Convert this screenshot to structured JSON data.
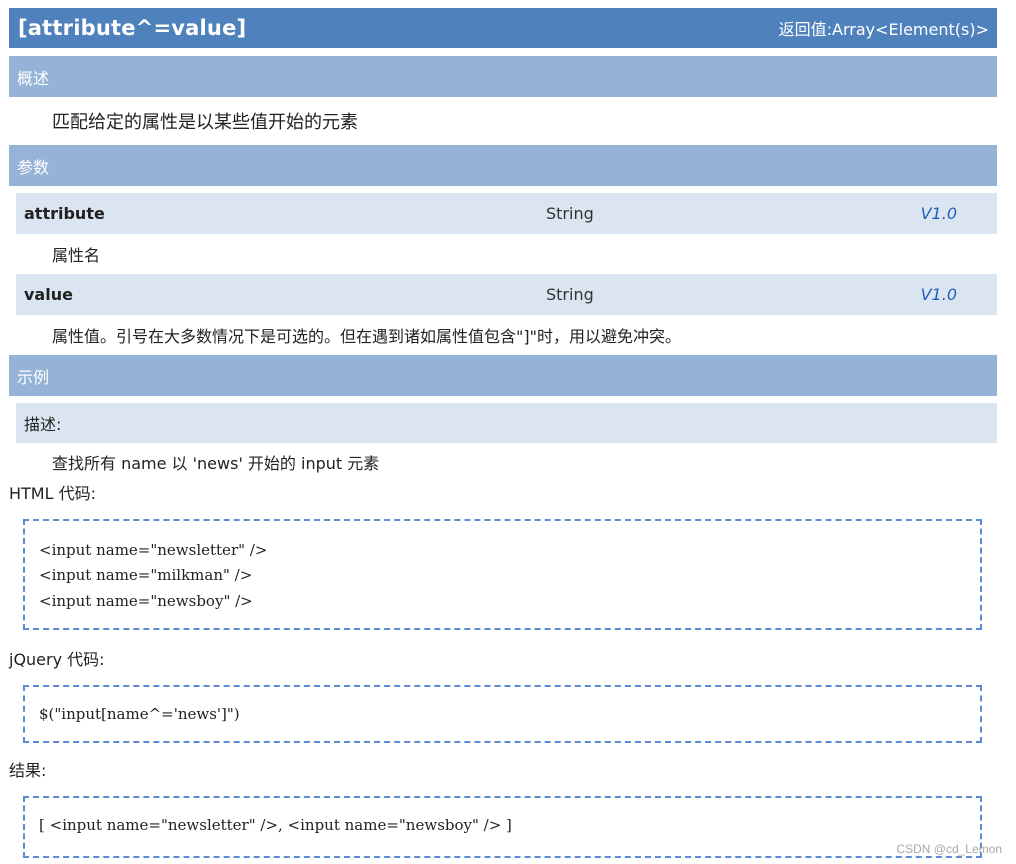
{
  "header": {
    "api_name": "[attribute^=value]",
    "return_type": "返回值:Array<Element(s)>"
  },
  "overview": {
    "section_label": "概述",
    "description": "匹配给定的属性是以某些值开始的元素"
  },
  "params": {
    "section_label": "参数",
    "items": [
      {
        "name": "attribute",
        "type": "String",
        "version": "V1.0",
        "description": "属性名"
      },
      {
        "name": "value",
        "type": "String",
        "version": "V1.0",
        "description": "属性值。引号在大多数情况下是可选的。但在遇到诸如属性值包含\"]\"时，用以避免冲突。"
      }
    ]
  },
  "example": {
    "section_label": "示例",
    "desc_label": "描述:",
    "desc_text": "查找所有 name 以 'news' 开始的 input 元素",
    "html_label": "HTML 代码:",
    "html_lines": [
      "<input name=\"newsletter\" />",
      "<input name=\"milkman\" />",
      "<input name=\"newsboy\" />"
    ],
    "jquery_label": "jQuery 代码:",
    "jquery_lines": [
      "$(\"input[name^='news']\")"
    ],
    "result_label": "结果:",
    "result_lines": [
      "[ <input name=\"newsletter\" />, <input name=\"newsboy\" /> ]"
    ]
  },
  "watermark": "CSDN @cd_Lemon",
  "colors": {
    "title_bar": "#4f81bd",
    "section_bar": "#95b3d7",
    "param_row": "#dbe5f1",
    "version_text": "#1f5fb8",
    "code_border": "#5b8bd0"
  }
}
